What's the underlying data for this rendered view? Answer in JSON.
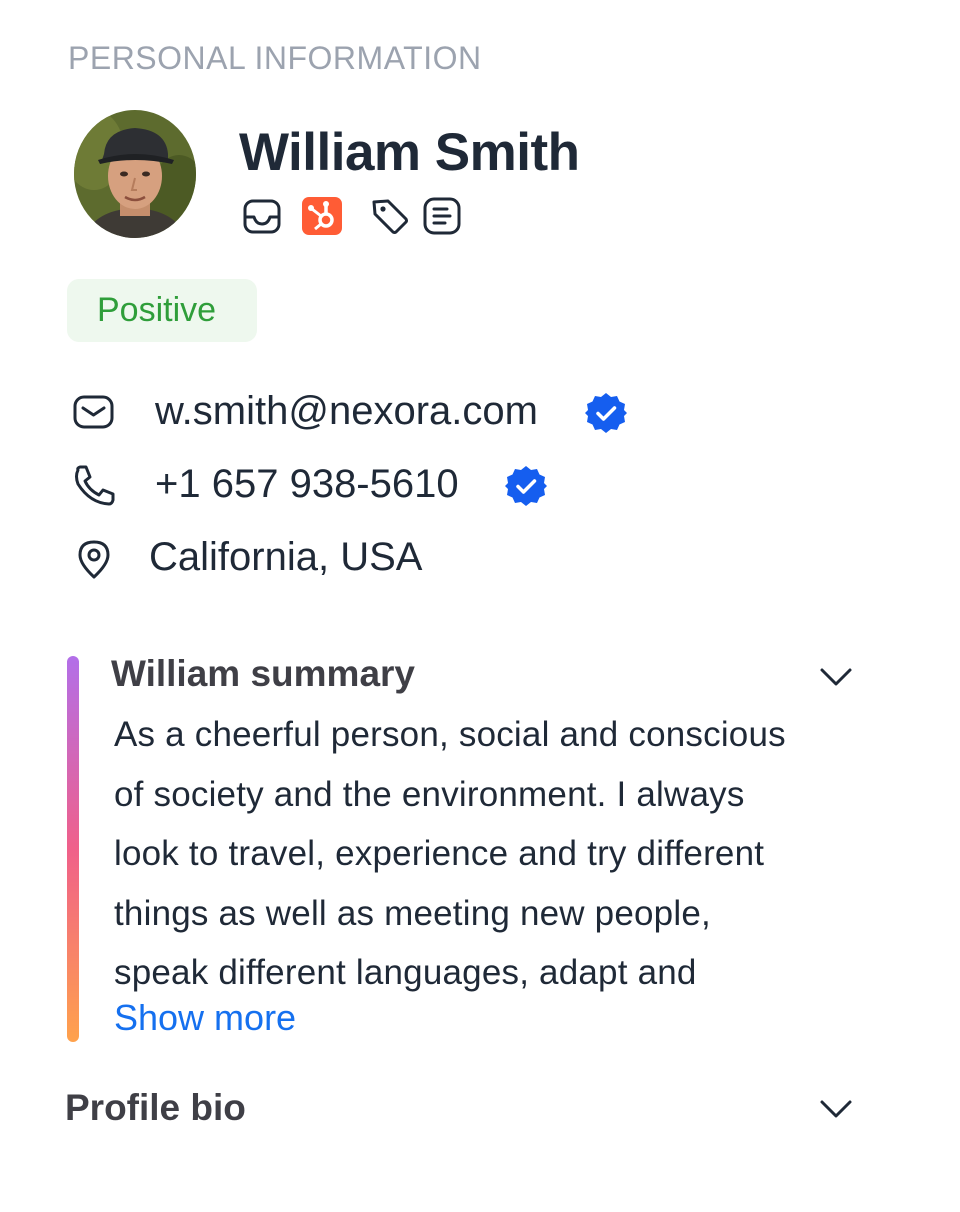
{
  "section": {
    "title": "PERSONAL INFORMATION"
  },
  "profile": {
    "name": "William Smith",
    "avatar_icon": "user-avatar-photo",
    "integration_icons": [
      "inbox-icon",
      "hubspot-icon",
      "tag-icon",
      "notes-icon"
    ],
    "sentiment": "Positive"
  },
  "contact": {
    "email": "w.smith@nexora.com",
    "email_verified": true,
    "phone": "+1 657 938-5610",
    "phone_verified": true,
    "location": "California, USA"
  },
  "summary": {
    "title": "William summary",
    "lines": [
      "As a cheerful person, social and conscious",
      "of society and the environment. I always",
      "look to travel, experience and try different",
      "things as well as meeting new people,",
      "speak different languages, adapt and"
    ],
    "show_more": "Show more",
    "expanded": true
  },
  "bio": {
    "title": "Profile bio",
    "expanded": false
  },
  "colors": {
    "accent_blue": "#1570ef",
    "verified_blue": "#155eef",
    "positive_green": "#2f9e3a",
    "positive_bg": "#eef8ee",
    "hubspot_orange": "#ff5c35",
    "summary_gradient": [
      "#b26fe9",
      "#f0608a",
      "#ffa24c"
    ]
  }
}
